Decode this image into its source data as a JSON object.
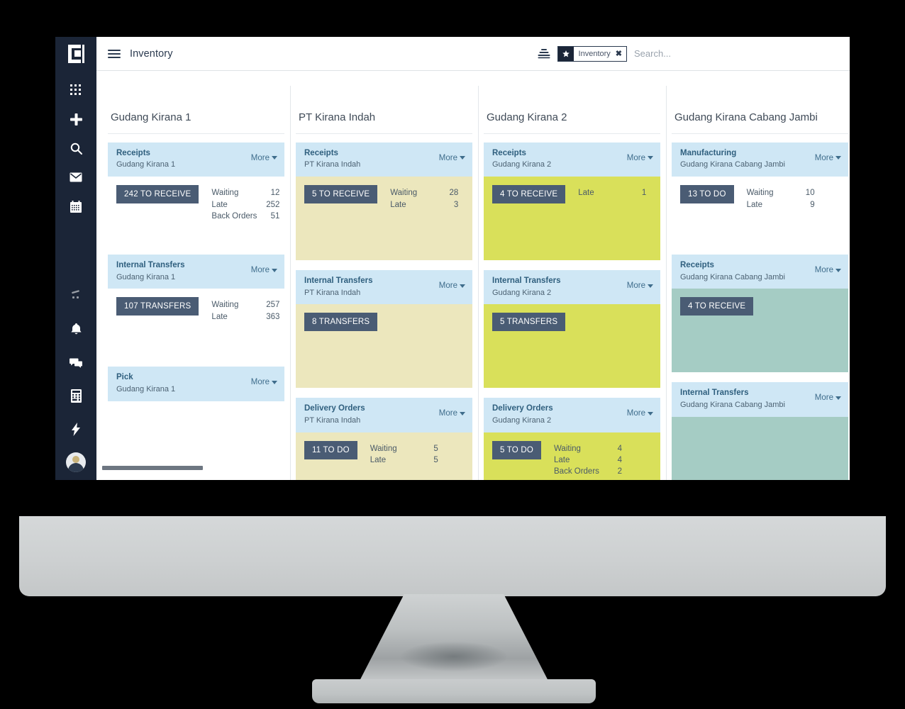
{
  "app": {
    "title": "Inventory",
    "menu_icon": "hamburger-icon",
    "logo_icon": "odoo-logo-icon"
  },
  "topbar": {
    "filter_icon": "filter-icon",
    "facet": {
      "star_icon": "star-icon",
      "label": "Inventory",
      "remove": "✖"
    },
    "search_placeholder": "Search...",
    "search_value": ""
  },
  "sidebar": {
    "top_icons": [
      {
        "name": "apps-grid-icon"
      },
      {
        "name": "plus-icon"
      },
      {
        "name": "search-icon"
      },
      {
        "name": "mail-icon"
      },
      {
        "name": "calendar-icon"
      }
    ],
    "bottom_icons": [
      {
        "name": "discount-percent-icon"
      },
      {
        "name": "bell-icon"
      },
      {
        "name": "chat-bubbles-icon"
      },
      {
        "name": "calculator-icon"
      },
      {
        "name": "lightning-bolt-icon"
      },
      {
        "name": "user-avatar-icon"
      }
    ]
  },
  "board": {
    "more_label": "More",
    "columns": [
      {
        "title": "Gudang Kirana 1",
        "cards": [
          {
            "name": "Receipts",
            "sub": "Gudang Kirana 1",
            "pill": "242 TO RECEIVE",
            "body_style": "blank",
            "stats": [
              {
                "label": "Waiting",
                "value": "12"
              },
              {
                "label": "Late",
                "value": "252"
              },
              {
                "label": "Back Orders",
                "value": "51"
              }
            ]
          },
          {
            "name": "Internal Transfers",
            "sub": "Gudang Kirana 1",
            "pill": "107 TRANSFERS",
            "body_style": "blank",
            "stats": [
              {
                "label": "Waiting",
                "value": "257"
              },
              {
                "label": "Late",
                "value": "363"
              }
            ]
          },
          {
            "name": "Pick",
            "sub": "Gudang Kirana 1",
            "pill": "",
            "body_style": "blank",
            "stats": []
          }
        ]
      },
      {
        "title": "PT Kirana Indah",
        "cards": [
          {
            "name": "Receipts",
            "sub": "PT Kirana Indah",
            "pill": "5 TO RECEIVE",
            "body_style": "khaki",
            "stats": [
              {
                "label": "Waiting",
                "value": "28"
              },
              {
                "label": "Late",
                "value": "3"
              }
            ]
          },
          {
            "name": "Internal Transfers",
            "sub": "PT Kirana Indah",
            "pill": "8 TRANSFERS",
            "body_style": "khaki",
            "stats": []
          },
          {
            "name": "Delivery Orders",
            "sub": "PT Kirana Indah",
            "pill": "11 TO DO",
            "body_style": "khaki",
            "stats": [
              {
                "label": "Waiting",
                "value": "5"
              },
              {
                "label": "Late",
                "value": "5"
              }
            ]
          }
        ]
      },
      {
        "title": "Gudang Kirana 2",
        "cards": [
          {
            "name": "Receipts",
            "sub": "Gudang Kirana 2",
            "pill": "4 TO RECEIVE",
            "body_style": "lime",
            "stats": [
              {
                "label": "Late",
                "value": "1"
              }
            ]
          },
          {
            "name": "Internal Transfers",
            "sub": "Gudang Kirana 2",
            "pill": "5 TRANSFERS",
            "body_style": "lime",
            "stats": []
          },
          {
            "name": "Delivery Orders",
            "sub": "Gudang Kirana 2",
            "pill": "5 TO DO",
            "body_style": "lime",
            "stats": [
              {
                "label": "Waiting",
                "value": "4"
              },
              {
                "label": "Late",
                "value": "4"
              },
              {
                "label": "Back Orders",
                "value": "2"
              }
            ]
          }
        ]
      },
      {
        "title": "Gudang Kirana Cabang Jambi",
        "cards": [
          {
            "name": "Manufacturing",
            "sub": "Gudang Kirana Cabang Jambi",
            "pill": "13 TO DO",
            "body_style": "blank",
            "stats": [
              {
                "label": "Waiting",
                "value": "10"
              },
              {
                "label": "Late",
                "value": "9"
              }
            ]
          },
          {
            "name": "Receipts",
            "sub": "Gudang Kirana Cabang Jambi",
            "pill": "4 TO RECEIVE",
            "body_style": "teal",
            "stats": []
          },
          {
            "name": "Internal Transfers",
            "sub": "Gudang Kirana Cabang Jambi",
            "pill": "",
            "body_style": "teal",
            "stats": []
          }
        ]
      }
    ]
  },
  "colors": {
    "sidebar_bg": "#1b2537",
    "card_header": "#cfe7f5",
    "pill_bg": "#4a5c74",
    "body_khaki": "#ece7bd",
    "body_lime": "#d9e05a",
    "body_teal": "#a5ccc4"
  }
}
